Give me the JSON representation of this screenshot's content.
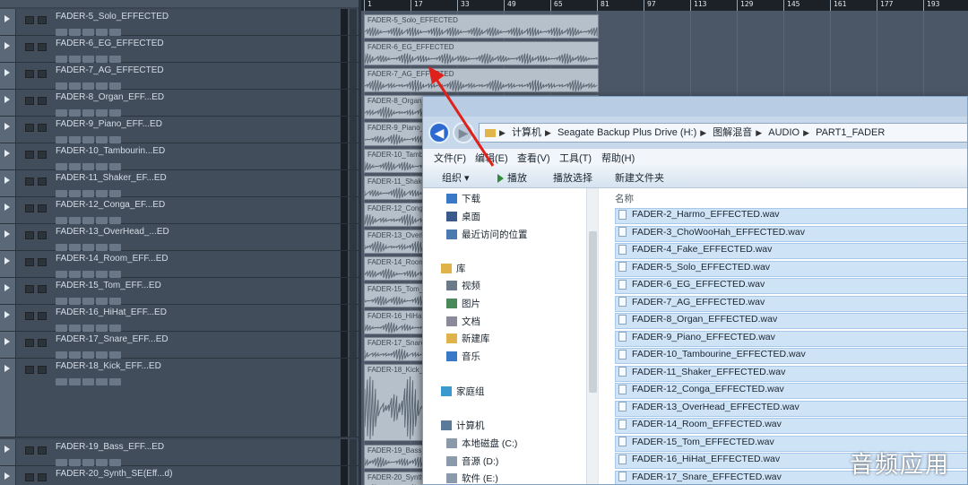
{
  "tracks": [
    {
      "name": "FADER-5_Solo_EFFECTED"
    },
    {
      "name": "FADER-6_EG_EFFECTED"
    },
    {
      "name": "FADER-7_AG_EFFECTED"
    },
    {
      "name": "FADER-8_Organ_EFF...ED"
    },
    {
      "name": "FADER-9_Piano_EFF...ED"
    },
    {
      "name": "FADER-10_Tambourin...ED"
    },
    {
      "name": "FADER-11_Shaker_EF...ED"
    },
    {
      "name": "FADER-12_Conga_EF...ED"
    },
    {
      "name": "FADER-13_OverHead_...ED"
    },
    {
      "name": "FADER-14_Room_EFF...ED"
    },
    {
      "name": "FADER-15_Tom_EFF...ED"
    },
    {
      "name": "FADER-16_HiHat_EFF...ED"
    },
    {
      "name": "FADER-17_Snare_EFF...ED"
    },
    {
      "name": "FADER-18_Kick_EFF...ED"
    },
    {
      "name": "FADER-19_Bass_EFF...ED"
    },
    {
      "name": "FADER-20_Synth_SE(Eff...d)"
    }
  ],
  "ruler": [
    "1",
    "17",
    "33",
    "49",
    "65",
    "81",
    "97",
    "113",
    "129",
    "145",
    "161",
    "177",
    "193"
  ],
  "clips": [
    {
      "label": "FADER-5_Solo_EFFECTED"
    },
    {
      "label": "FADER-6_EG_EFFECTED"
    },
    {
      "label": "FADER-7_AG_EFFECTED"
    },
    {
      "label": "FADER-8_Organ_"
    },
    {
      "label": "FADER-9_Piano_"
    },
    {
      "label": "FADER-10_Tamb"
    },
    {
      "label": "FADER-11_Shake"
    },
    {
      "label": "FADER-12_Conga"
    },
    {
      "label": "FADER-13_Overh"
    },
    {
      "label": "FADER-14_Room"
    },
    {
      "label": "FADER-15_Tom_"
    },
    {
      "label": "FADER-16_HiHat"
    },
    {
      "label": "FADER-17_Snare"
    },
    {
      "label": "FADER-18_Kick_"
    },
    {
      "label": "FADER-19_Bass_"
    },
    {
      "label": "FADER-20_Synth"
    }
  ],
  "explorer": {
    "breadcrumbs": [
      "计算机",
      "Seagate Backup Plus Drive (H:)",
      "图解混音",
      "AUDIO",
      "PART1_FADER"
    ],
    "menu": [
      "文件(F)",
      "编辑(E)",
      "查看(V)",
      "工具(T)",
      "帮助(H)"
    ],
    "toolbar": {
      "organize": "组织 ▾",
      "play": "播放",
      "play_selection": "播放选择",
      "new_folder": "新建文件夹"
    },
    "nav": [
      {
        "label": "下载",
        "icon": "download-icon"
      },
      {
        "label": "桌面",
        "icon": "desktop-icon"
      },
      {
        "label": "最近访问的位置",
        "icon": "recent-places-icon"
      },
      {
        "label": "库",
        "icon": "library-icon"
      },
      {
        "label": "视频",
        "icon": "video-icon"
      },
      {
        "label": "图片",
        "icon": "picture-icon"
      },
      {
        "label": "文档",
        "icon": "document-icon"
      },
      {
        "label": "新建库",
        "icon": "new-library-icon"
      },
      {
        "label": "音乐",
        "icon": "music-icon"
      },
      {
        "label": "家庭组",
        "icon": "homegroup-icon"
      },
      {
        "label": "计算机",
        "icon": "computer-icon"
      },
      {
        "label": "本地磁盘 (C:)",
        "icon": "drive-icon"
      },
      {
        "label": "音源 (D:)",
        "icon": "drive-icon"
      },
      {
        "label": "软件 (E:)",
        "icon": "drive-icon"
      }
    ],
    "column_header": "名称",
    "files": [
      "FADER-2_Harmo_EFFECTED.wav",
      "FADER-3_ChoWooHah_EFFECTED.wav",
      "FADER-4_Fake_EFFECTED.wav",
      "FADER-5_Solo_EFFECTED.wav",
      "FADER-6_EG_EFFECTED.wav",
      "FADER-7_AG_EFFECTED.wav",
      "FADER-8_Organ_EFFECTED.wav",
      "FADER-9_Piano_EFFECTED.wav",
      "FADER-10_Tambourine_EFFECTED.wav",
      "FADER-11_Shaker_EFFECTED.wav",
      "FADER-12_Conga_EFFECTED.wav",
      "FADER-13_OverHead_EFFECTED.wav",
      "FADER-14_Room_EFFECTED.wav",
      "FADER-15_Tom_EFFECTED.wav",
      "FADER-16_HiHat_EFFECTED.wav",
      "FADER-17_Snare_EFFECTED.wav"
    ]
  },
  "watermark": "音频应用",
  "colors": {
    "accent": "#2e6bd0",
    "arrow": "#e0201a",
    "selection": "#cfe3f7"
  }
}
